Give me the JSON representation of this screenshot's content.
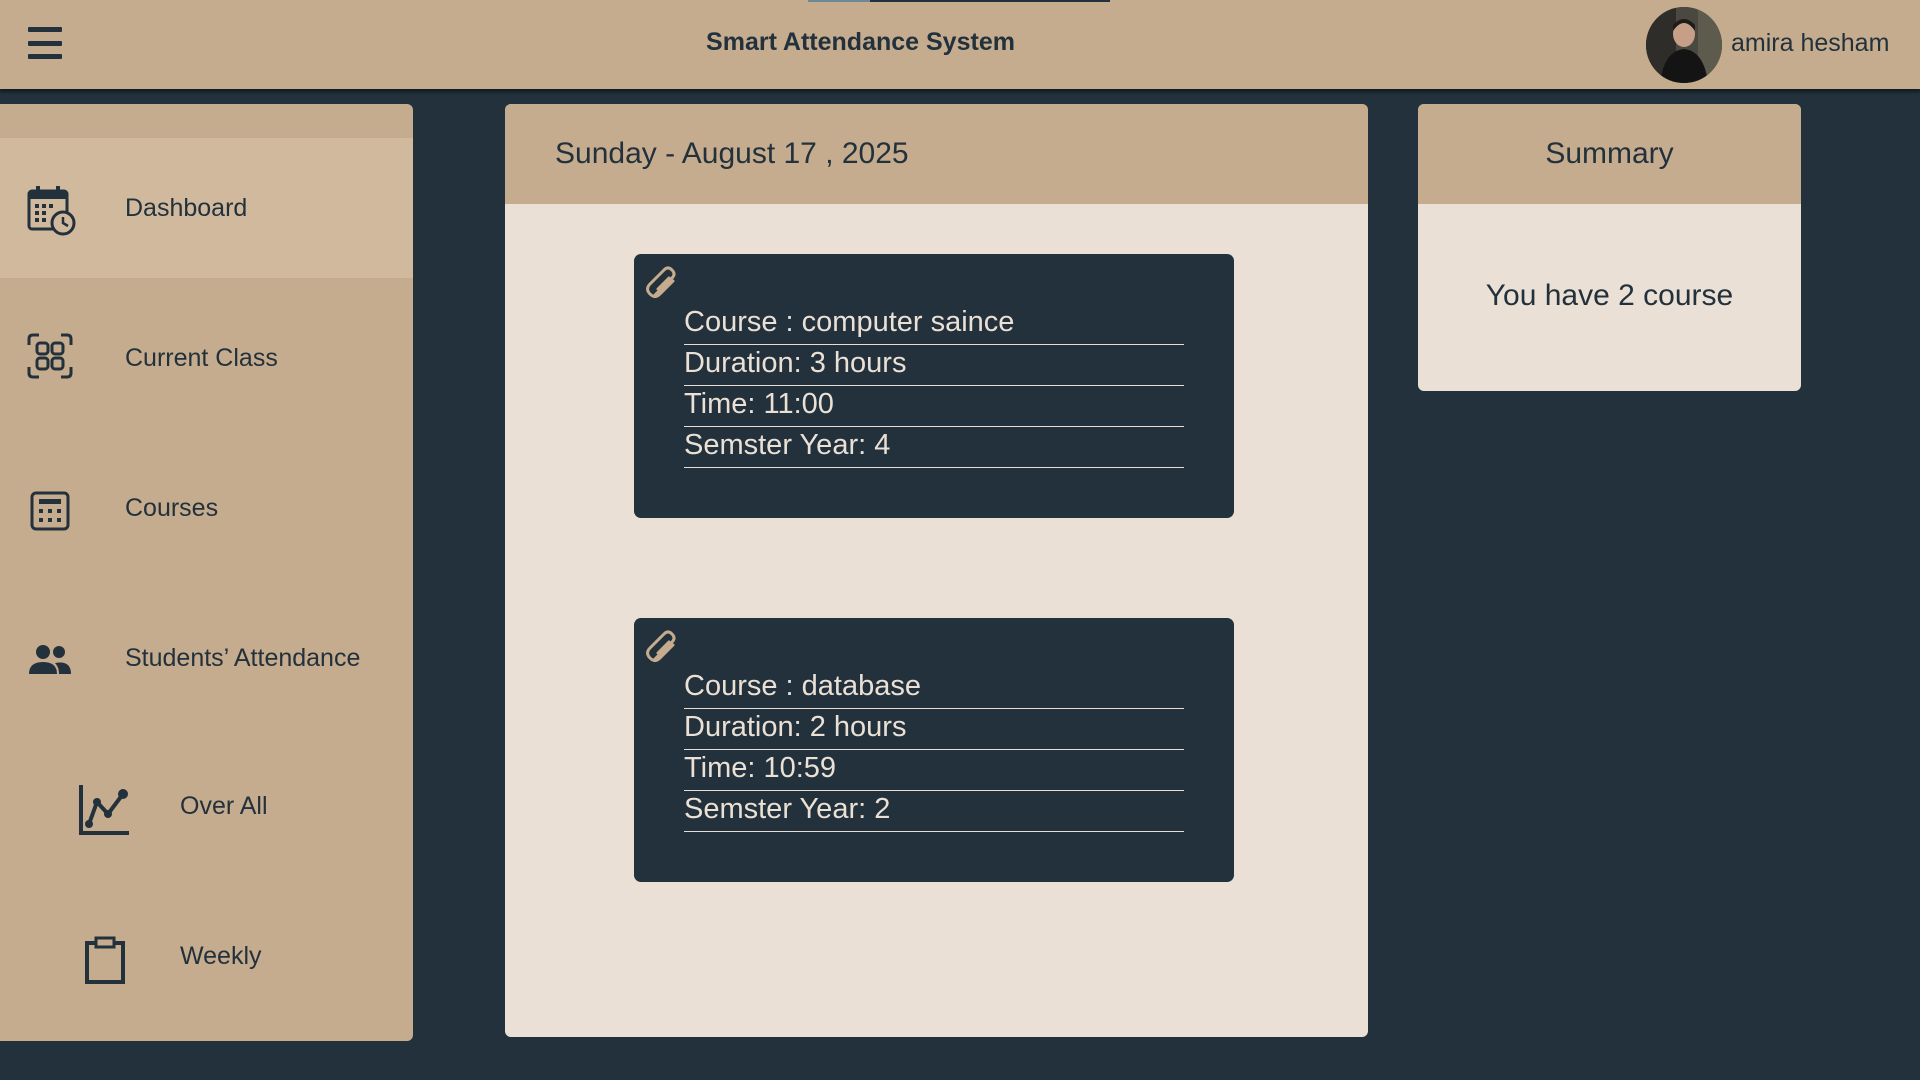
{
  "app": {
    "title": "Smart Attendance System"
  },
  "user": {
    "name": "amira hesham"
  },
  "sidebar": {
    "items": [
      {
        "label": "Dashboard",
        "icon": "calendar-clock-icon",
        "active": true
      },
      {
        "label": "Current Class",
        "icon": "grid-icon"
      },
      {
        "label": "Courses",
        "icon": "calculator-icon"
      },
      {
        "label": "Students’ Attendance",
        "icon": "people-icon"
      },
      {
        "label": "Over All",
        "icon": "line-chart-icon"
      },
      {
        "label": "Weekly",
        "icon": "clipboard-icon"
      }
    ]
  },
  "main": {
    "date": "Sunday - August 17 , 2025",
    "courses": [
      {
        "course": "Course : computer saince",
        "duration": "Duration: 3 hours",
        "time": "Time: 11:00",
        "year": "Semster Year: 4"
      },
      {
        "course": "Course : database",
        "duration": "Duration: 2 hours",
        "time": "Time: 10:59",
        "year": "Semster Year: 2"
      }
    ]
  },
  "summary": {
    "title": "Summary",
    "text": "You have 2 course"
  },
  "colors": {
    "background": "#22313b",
    "tan": "#c6ac8e",
    "active_tan": "#d1b99e",
    "cream": "#eae0d5",
    "dark": "#22313b"
  }
}
